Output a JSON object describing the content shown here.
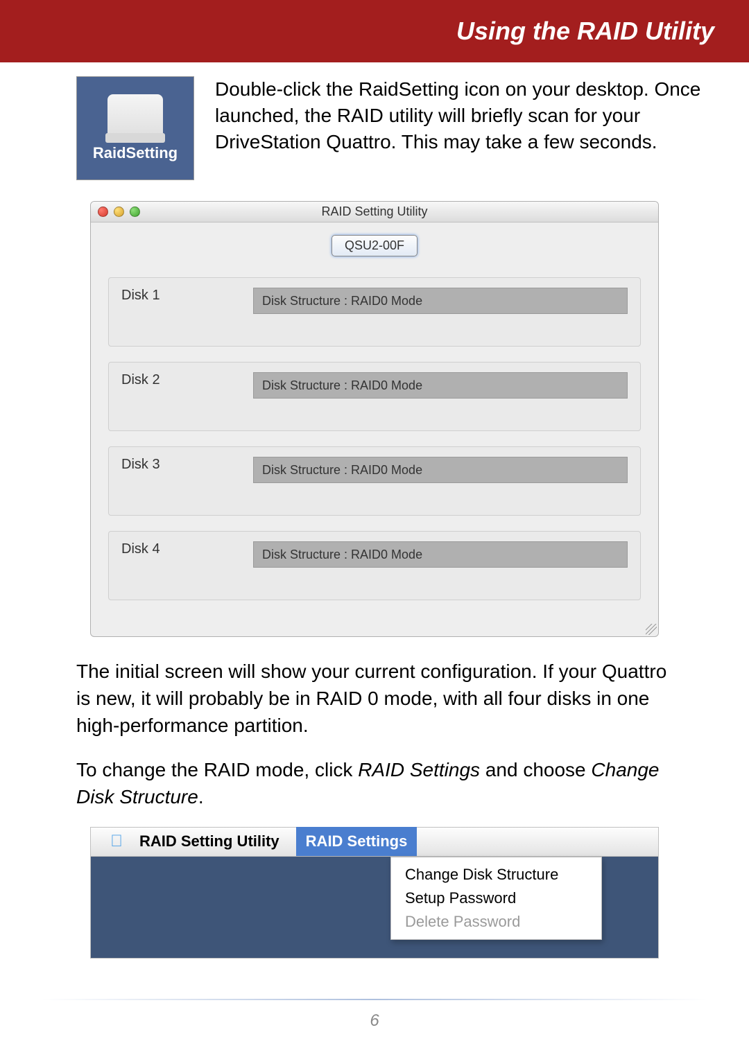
{
  "header": {
    "title": "Using the RAID Utility"
  },
  "icon": {
    "label": "RaidSetting"
  },
  "intro": "Double-click the RaidSetting icon on your desktop. Once launched, the RAID utility will briefly scan for your DriveStation Quattro.  This may take a few seconds.",
  "window": {
    "title": "RAID Setting Utility",
    "tab": "QSU2-00F",
    "disks": [
      {
        "label": "Disk 1",
        "structure": "Disk Structure : RAID0 Mode"
      },
      {
        "label": "Disk 2",
        "structure": "Disk Structure : RAID0 Mode"
      },
      {
        "label": "Disk 3",
        "structure": "Disk Structure : RAID0 Mode"
      },
      {
        "label": "Disk 4",
        "structure": "Disk Structure : RAID0 Mode"
      }
    ]
  },
  "para1": "The initial screen will show your current configuration.  If your Quattro is new, it will probably be in RAID 0 mode, with all four disks in one high-performance partition.",
  "para2_a": "To change the RAID mode, click ",
  "para2_i1": "RAID Settings",
  "para2_b": " and choose ",
  "para2_i2": "Change Disk Structure",
  "para2_c": ".",
  "menubar": {
    "app": "RAID Setting Utility",
    "open": "RAID Settings",
    "items": [
      {
        "label": "Change Disk Structure",
        "enabled": true
      },
      {
        "label": "Setup Password",
        "enabled": true
      },
      {
        "label": "Delete Password",
        "enabled": false
      }
    ]
  },
  "page_number": "6"
}
